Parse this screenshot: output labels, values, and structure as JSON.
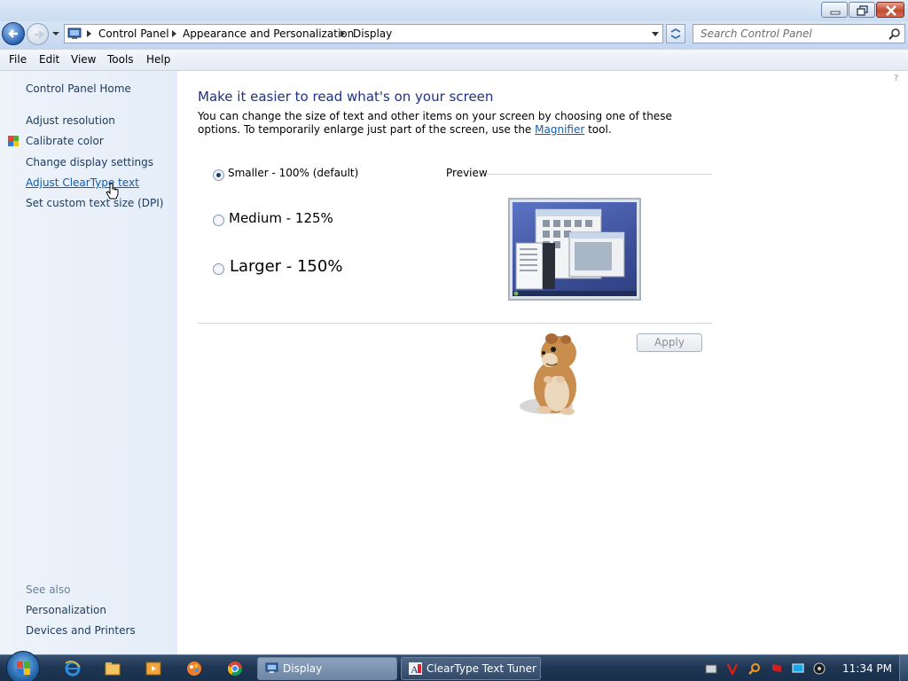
{
  "address": {
    "crumbs": [
      "Control Panel",
      "Appearance and Personalization",
      "Display"
    ]
  },
  "search": {
    "placeholder": "Search Control Panel"
  },
  "menu": [
    "File",
    "Edit",
    "View",
    "Tools",
    "Help"
  ],
  "sidebar": {
    "home": "Control Panel Home",
    "links": [
      "Adjust resolution",
      "Calibrate color",
      "Change display settings",
      "Adjust ClearType text",
      "Set custom text size (DPI)"
    ],
    "see_also": "See also",
    "see_also_links": [
      "Personalization",
      "Devices and Printers"
    ]
  },
  "main": {
    "title": "Make it easier to read what's on your screen",
    "desc_before": "You can change the size of text and other items on your screen by choosing one of these options. To temporarily enlarge just part of the screen, use the ",
    "desc_link": "Magnifier",
    "desc_after": " tool.",
    "options": [
      "Smaller - 100% (default)",
      "Medium - 125%",
      "Larger - 150%"
    ],
    "selected_option": 0,
    "preview_label": "Preview",
    "apply_label": "Apply"
  },
  "taskbar": {
    "tasks": [
      "Display",
      "ClearType Text Tuner"
    ],
    "clock": "11:34 PM"
  },
  "colors": {
    "title_blue": "#1e3287",
    "link_blue": "#0d5fae",
    "sidebar_bg": "#e9f0fa",
    "taskbar": "#1e3552"
  }
}
